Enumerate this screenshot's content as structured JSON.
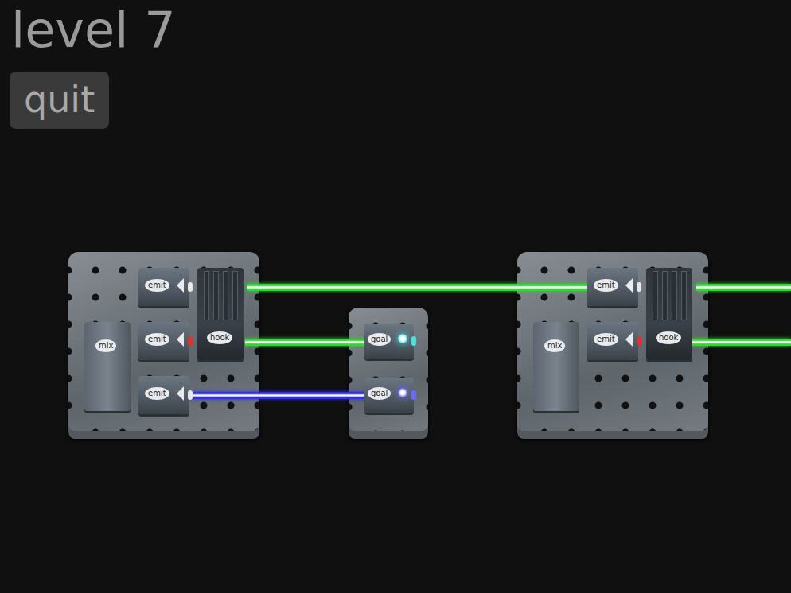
{
  "title": "level 7",
  "buttons": [
    {
      "label": "quit"
    }
  ],
  "boards": [
    {
      "components": [
        {
          "kind": "emit",
          "label": "emit",
          "port_color": "#e8e8e8"
        },
        {
          "kind": "emit",
          "label": "emit",
          "port_color": "#e03030"
        },
        {
          "kind": "emit",
          "label": "emit",
          "port_color": "#e8e8e8"
        },
        {
          "kind": "mix",
          "label": "mix"
        },
        {
          "kind": "hook",
          "label": "hook"
        }
      ]
    },
    {
      "components": [
        {
          "kind": "goal",
          "label": "goal",
          "lit": true,
          "color": "#4fe0e0"
        },
        {
          "kind": "goal",
          "label": "goal",
          "lit": true,
          "color": "#6a6aff"
        }
      ]
    },
    {
      "components": [
        {
          "kind": "emit",
          "label": "emit",
          "port_color": "#e8e8e8"
        },
        {
          "kind": "emit",
          "label": "emit",
          "port_color": "#e03030"
        },
        {
          "kind": "mix",
          "label": "mix"
        },
        {
          "kind": "hook",
          "label": "hook"
        }
      ]
    }
  ],
  "beams": [
    {
      "color": "#2fd82f"
    },
    {
      "color": "#2fd82f"
    },
    {
      "color": "#2fd82f"
    },
    {
      "color": "#2fd82f"
    },
    {
      "color": "#3030e8"
    }
  ]
}
